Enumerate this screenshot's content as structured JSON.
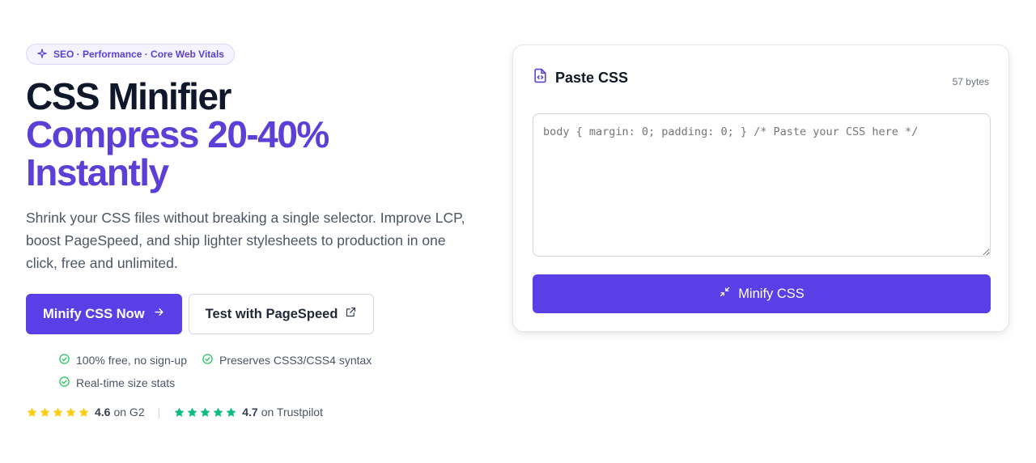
{
  "hero": {
    "badge": "SEO · Performance · Core Web Vitals",
    "title_line1": "CSS Minifier",
    "title_line2": "Compress 20-40%",
    "title_line3": "Instantly",
    "description": "Shrink your CSS files without breaking a single selector. Improve LCP, boost PageSpeed, and ship lighter stylesheets to production in one click, free and unlimited.",
    "primary_cta": "Minify CSS Now",
    "secondary_cta": "Test with PageSpeed",
    "features": [
      "100% free, no sign-up",
      "Preserves CSS3/CSS4 syntax",
      "Real-time size stats"
    ],
    "ratings": [
      {
        "value": "4.6",
        "source": "on G2",
        "star_color": "#facc15"
      },
      {
        "value": "4.7",
        "source": "on Trustpilot",
        "star_color": "#10b981"
      }
    ]
  },
  "card": {
    "title": "Paste CSS",
    "bytes": "57 bytes",
    "textarea_placeholder": "body { margin: 0; padding: 0; } /* Paste your CSS here */",
    "button": "Minify CSS"
  },
  "colors": {
    "accent": "#5b3fe6",
    "feature_check": "#22c55e"
  }
}
